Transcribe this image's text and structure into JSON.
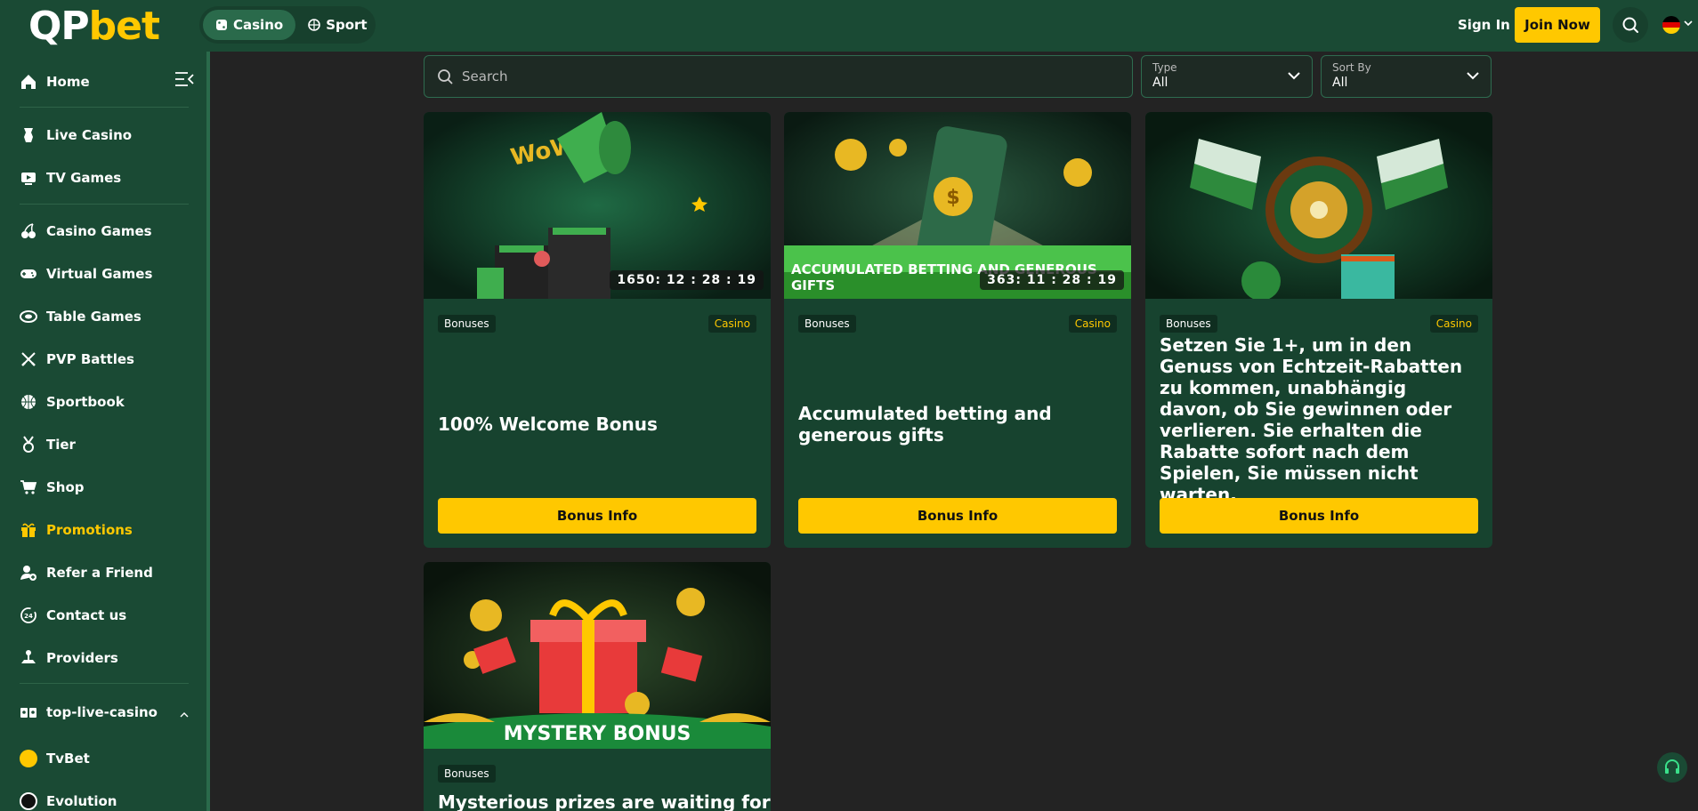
{
  "header": {
    "logo_part1": "QP",
    "logo_part2": "bet",
    "modes": [
      {
        "label": "Casino",
        "icon": "dice-icon",
        "active": true
      },
      {
        "label": "Sport",
        "icon": "ball-icon",
        "active": false
      }
    ],
    "signin_label": "Sign In",
    "join_label": "Join Now",
    "language": "de"
  },
  "sidebar": {
    "items": [
      {
        "label": "Home",
        "icon": "home-icon"
      },
      {
        "label": "Live Casino",
        "icon": "live-casino-icon"
      },
      {
        "label": "TV Games",
        "icon": "tv-icon"
      },
      {
        "label": "Casino Games",
        "icon": "cherries-icon"
      },
      {
        "label": "Virtual Games",
        "icon": "gamepad-icon"
      },
      {
        "label": "Table Games",
        "icon": "table-icon"
      },
      {
        "label": "PVP Battles",
        "icon": "swords-icon"
      },
      {
        "label": "Sportbook",
        "icon": "basketball-icon"
      },
      {
        "label": "Tier",
        "icon": "medal-icon"
      },
      {
        "label": "Shop",
        "icon": "cart-icon"
      },
      {
        "label": "Promotions",
        "icon": "gift-icon",
        "active": true
      },
      {
        "label": "Refer a Friend",
        "icon": "refer-icon"
      },
      {
        "label": "Contact us",
        "icon": "support-24-icon"
      },
      {
        "label": "Providers",
        "icon": "joystick-icon"
      },
      {
        "label": "top-live-casino",
        "icon": "cards-icon"
      },
      {
        "label": "TvBet",
        "icon": "tvbet-icon"
      },
      {
        "label": "Evolution",
        "icon": "evolution-icon"
      }
    ]
  },
  "filters": {
    "search_placeholder": "Search",
    "type_label": "Type",
    "type_value": "All",
    "sort_label": "Sort By",
    "sort_value": "All"
  },
  "promotions": [
    {
      "tag": "Bonuses",
      "category": "Casino",
      "title": "100% Welcome Bonus",
      "countdown": "1650: 12 : 28 : 19",
      "button": "Bonus Info"
    },
    {
      "tag": "Bonuses",
      "category": "Casino",
      "title": "Accumulated betting and generous gifts",
      "countdown": "363: 11 : 28 : 19",
      "image_caption": "ACCUMULATED BETTING AND GENEROUS GIFTS",
      "button": "Bonus Info"
    },
    {
      "tag": "Bonuses",
      "category": "Casino",
      "title": "Setzen Sie 1+, um in den Genuss von Echtzeit-Rabatten zu kommen, unabhängig davon, ob Sie gewinnen oder verlieren. Sie erhalten die Rabatte sofort nach dem Spielen, Sie müssen nicht warten.",
      "button": "Bonus Info"
    },
    {
      "tag": "Bonuses",
      "title": "Mysterious prizes are waiting for",
      "image_caption": "MYSTERY BONUS"
    }
  ],
  "colors": {
    "brand_green": "#1a4a34",
    "accent_yellow": "#ffc800",
    "background": "#232323"
  }
}
